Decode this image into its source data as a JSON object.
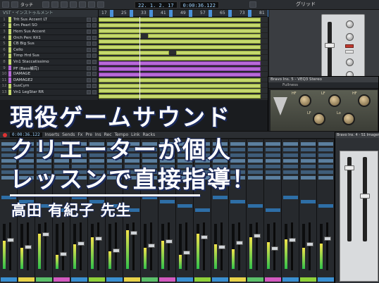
{
  "transport": {
    "position": "22. 1. 2. 17",
    "time": "0:00:36.122",
    "grid_label": "グリッド",
    "mode_label": "タッチ"
  },
  "tracklist": {
    "header": "VST・インストゥルメント",
    "tracks": [
      {
        "num": "1",
        "name": "Trlt Sus Accent LT",
        "color": "#c5d86d"
      },
      {
        "num": "2",
        "name": "6m Pearl SO",
        "color": "#c5d86d"
      },
      {
        "num": "3",
        "name": "Horn Sus Accent",
        "color": "#c5d86d"
      },
      {
        "num": "4",
        "name": "Orch Perc Kit1",
        "color": "#c5d86d"
      },
      {
        "num": "5",
        "name": "CB Big Sus",
        "color": "#c5d86d"
      },
      {
        "num": "6",
        "name": "Cello",
        "color": "#c5d86d"
      },
      {
        "num": "7",
        "name": "Timp Hrd Sus",
        "color": "#c5d86d"
      },
      {
        "num": "8",
        "name": "Vn1 Staccatissimo",
        "color": "#c5d86d"
      },
      {
        "num": "9",
        "name": "PF (Bass補完)",
        "color": "#b869d8"
      },
      {
        "num": "10",
        "name": "DAMAGE",
        "color": "#b869d8"
      },
      {
        "num": "11",
        "name": "DAMAGE2",
        "color": "#b869d8"
      },
      {
        "num": "12",
        "name": "SusCym",
        "color": "#c5d86d"
      },
      {
        "num": "13",
        "name": "Vn1 LegStar RR",
        "color": "#c5d86d"
      }
    ]
  },
  "ruler": {
    "marks": [
      "17",
      "25",
      "33",
      "41",
      "49",
      "57",
      "65",
      "73",
      "81"
    ]
  },
  "eq_plugin": {
    "title": "Bravo Ins. 5 - VEQ3 Stereo",
    "preset": "Fullness",
    "bands": [
      "HF",
      "LF",
      "HF",
      "LF",
      "Lo"
    ]
  },
  "channel_plugin": {
    "labels": [
      "Low Band",
      "Mid",
      "Hi",
      "Sat",
      "Out"
    ]
  },
  "imager_plugin": {
    "title": "Bravo Ins. 4 - S1 Imager Shuffler"
  },
  "editor_bar": {
    "position": "0:00:36.122",
    "items": [
      "Inserts",
      "Sends",
      "Fx",
      "Pre",
      "Ins",
      "Rec",
      "Tempo",
      "Link",
      "Racks"
    ]
  },
  "mixer": {
    "channel_count": 19
  },
  "overlay": {
    "line1": "現役ゲームサウンド",
    "line2": "クリエーターが個人",
    "line3": "レッスンで直接指導！",
    "teacher": "高田 有紀子 先生"
  },
  "colors": {
    "clip_green": "#c5d86d",
    "clip_purple": "#b869d8",
    "overlay_outline": "#1b2a5c",
    "insert_slot": "#3f5d7a"
  }
}
